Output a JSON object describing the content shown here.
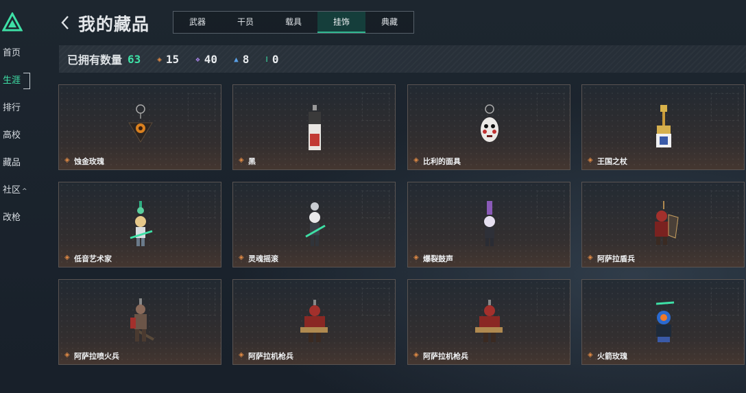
{
  "sidebar": {
    "items": [
      {
        "label": "首页"
      },
      {
        "label": "生涯",
        "active": true
      },
      {
        "label": "排行"
      },
      {
        "label": "高校"
      },
      {
        "label": "藏品"
      },
      {
        "label": "社区",
        "caret": "^"
      },
      {
        "label": "改枪"
      }
    ]
  },
  "header": {
    "title": "我的藏品",
    "tabs": [
      {
        "label": "武器"
      },
      {
        "label": "干员"
      },
      {
        "label": "载具"
      },
      {
        "label": "挂饰",
        "active": true
      },
      {
        "label": "典藏"
      }
    ]
  },
  "stats": {
    "owned_label": "已拥有数量",
    "owned_total": "63",
    "tiers": [
      {
        "color": "#e08a45",
        "value": "15"
      },
      {
        "color": "#a884e6",
        "value": "40"
      },
      {
        "color": "#5aa0e6",
        "value": "8"
      },
      {
        "color": "#3ee0a6",
        "value": "0"
      }
    ]
  },
  "items": [
    {
      "name": "蚀金玫瑰",
      "icon": "rose-charm-icon"
    },
    {
      "name": "黑",
      "icon": "black-banner-charm-icon"
    },
    {
      "name": "比利的面具",
      "icon": "billy-mask-charm-icon"
    },
    {
      "name": "王国之杖",
      "icon": "scepter-charm-icon"
    },
    {
      "name": "低音艺术家",
      "icon": "bassist-charm-icon"
    },
    {
      "name": "灵魂摇滚",
      "icon": "guitarist-charm-icon"
    },
    {
      "name": "爆裂鼓声",
      "icon": "drummer-charm-icon"
    },
    {
      "name": "阿萨拉盾兵",
      "icon": "shield-soldier-charm-icon"
    },
    {
      "name": "阿萨拉喷火兵",
      "icon": "flamethrower-soldier-charm-icon"
    },
    {
      "name": "阿萨拉机枪兵",
      "icon": "machinegunner-charm-icon"
    },
    {
      "name": "阿萨拉机枪兵",
      "icon": "machinegunner-charm-icon"
    },
    {
      "name": "火箭玫瑰",
      "icon": "rocket-rose-charm-icon"
    }
  ],
  "colors": {
    "accent": "#3ee0a6",
    "rarity_gold": "#e08a45"
  }
}
